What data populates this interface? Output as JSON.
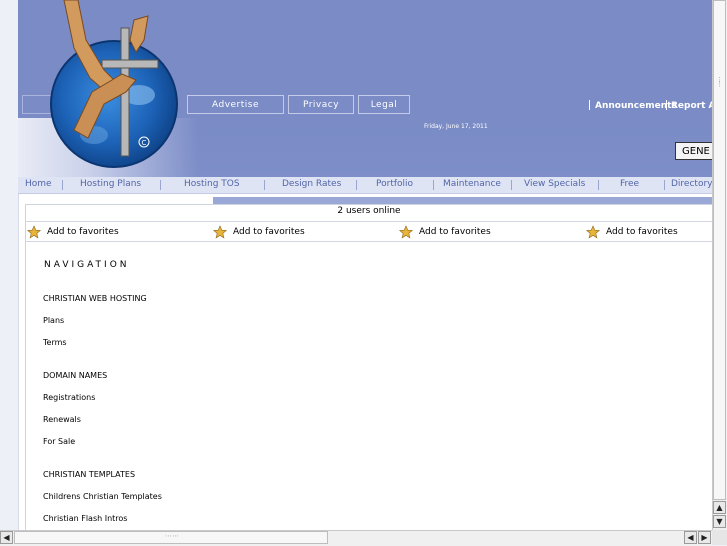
{
  "header": {
    "top_buttons": [
      "Advertise",
      "Privacy",
      "Legal"
    ],
    "date": "Friday, June 17, 2011",
    "right_links": [
      "Announcements",
      "Report A"
    ],
    "gen_button": "GENE"
  },
  "nav": {
    "items": [
      "Home",
      "Hosting Plans",
      "Hosting TOS",
      "Design Rates",
      "Portfolio",
      "Maintenance",
      "View Specials",
      "Free",
      "Directory"
    ]
  },
  "content": {
    "users_online": "2 users online",
    "favorites": [
      "Add to favorites",
      "Add to favorites",
      "Add to favorites",
      "Add to favorites"
    ],
    "navigation_title": "NAVIGATION",
    "sections": [
      {
        "heading": "CHRISTIAN WEB HOSTING",
        "links": [
          "Plans",
          "Terms"
        ]
      },
      {
        "heading": "DOMAIN NAMES",
        "links": [
          "Registrations",
          "Renewals",
          "For Sale"
        ]
      },
      {
        "heading": "CHRISTIAN TEMPLATES",
        "links": [
          "Childrens Christian Templates",
          "Christian Flash Intros"
        ]
      }
    ]
  },
  "colors": {
    "header_bg": "#7a8bc6",
    "nav_text": "#5265a8",
    "subbar": "#9aa8d8"
  }
}
